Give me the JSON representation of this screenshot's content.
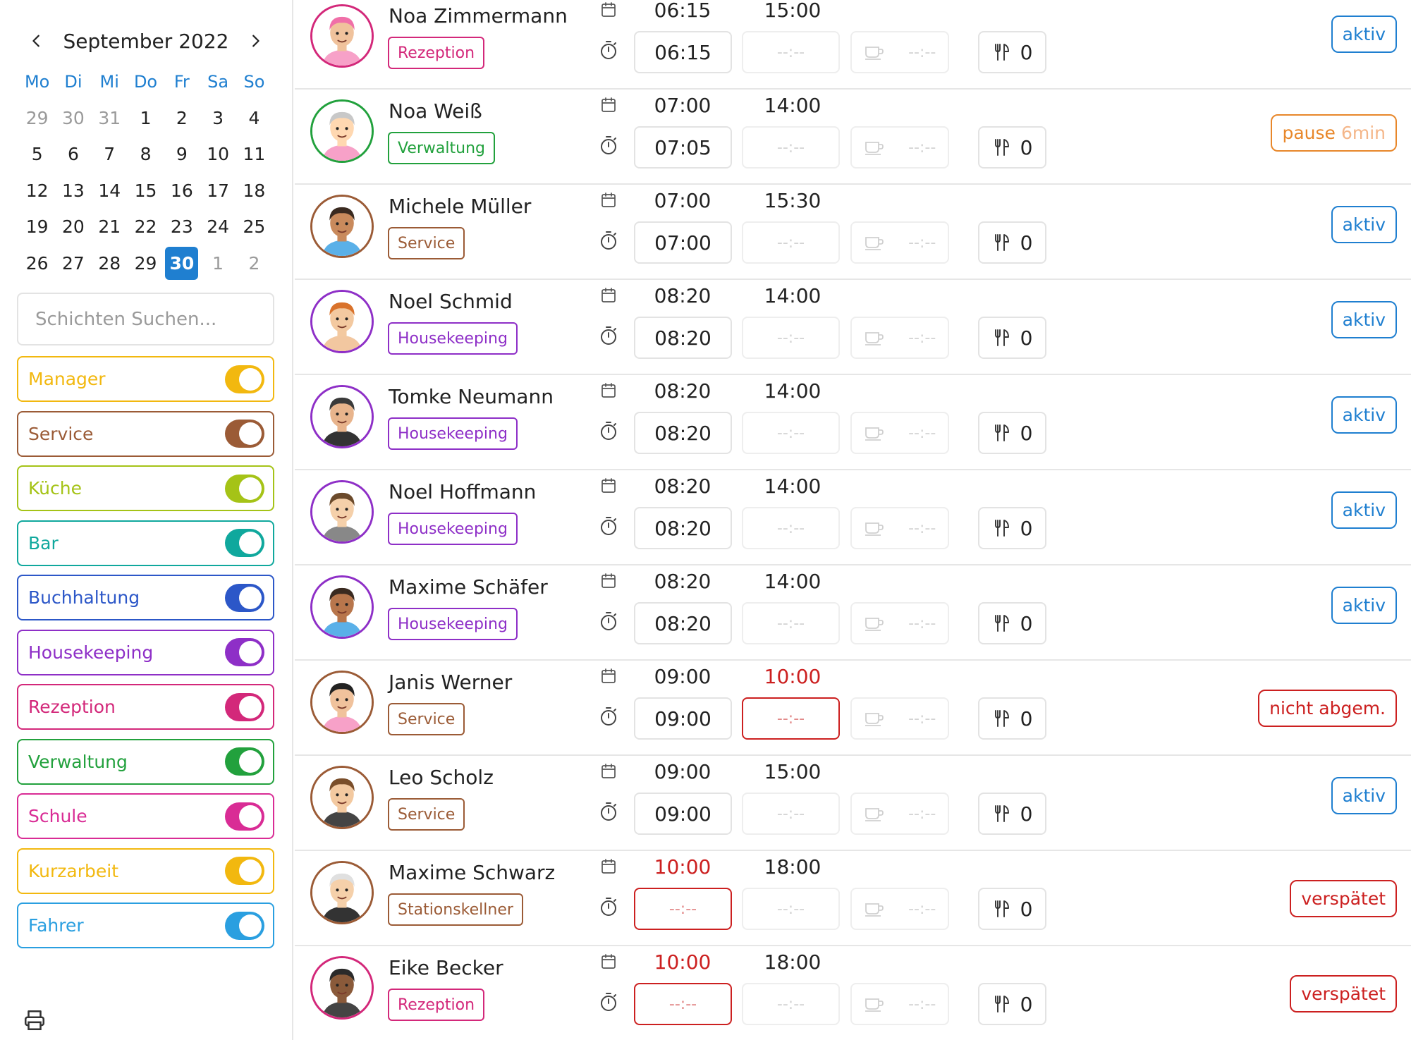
{
  "colors": {
    "accent": "#1f7fd0",
    "alert": "#cc2020",
    "pause": "#e8872a"
  },
  "calendar": {
    "month": "September 2022",
    "weekdays": [
      "Mo",
      "Di",
      "Mi",
      "Do",
      "Fr",
      "Sa",
      "So"
    ],
    "days": [
      {
        "label": "29",
        "muted": true
      },
      {
        "label": "30",
        "muted": true
      },
      {
        "label": "31",
        "muted": true
      },
      {
        "label": "1"
      },
      {
        "label": "2"
      },
      {
        "label": "3"
      },
      {
        "label": "4"
      },
      {
        "label": "5"
      },
      {
        "label": "6"
      },
      {
        "label": "7"
      },
      {
        "label": "8"
      },
      {
        "label": "9"
      },
      {
        "label": "10"
      },
      {
        "label": "11"
      },
      {
        "label": "12"
      },
      {
        "label": "13"
      },
      {
        "label": "14"
      },
      {
        "label": "15"
      },
      {
        "label": "16"
      },
      {
        "label": "17"
      },
      {
        "label": "18"
      },
      {
        "label": "19"
      },
      {
        "label": "20"
      },
      {
        "label": "21"
      },
      {
        "label": "22"
      },
      {
        "label": "23"
      },
      {
        "label": "24"
      },
      {
        "label": "25"
      },
      {
        "label": "26"
      },
      {
        "label": "27"
      },
      {
        "label": "28"
      },
      {
        "label": "29"
      },
      {
        "label": "30",
        "selected": true
      },
      {
        "label": "1",
        "muted": true
      },
      {
        "label": "2",
        "muted": true
      }
    ]
  },
  "search": {
    "placeholder": "Schichten Suchen...",
    "value": ""
  },
  "filters": [
    {
      "label": "Manager",
      "color": "#f2b80f",
      "on": true
    },
    {
      "label": "Service",
      "color": "#9b5b36",
      "on": true
    },
    {
      "label": "Küche",
      "color": "#a5c317",
      "on": true
    },
    {
      "label": "Bar",
      "color": "#10a89d",
      "on": true
    },
    {
      "label": "Buchhaltung",
      "color": "#2c57c8",
      "on": true
    },
    {
      "label": "Housekeeping",
      "color": "#8e2fc7",
      "on": true
    },
    {
      "label": "Rezeption",
      "color": "#d3287a",
      "on": true
    },
    {
      "label": "Verwaltung",
      "color": "#22a13d",
      "on": true
    },
    {
      "label": "Schule",
      "color": "#d92c95",
      "on": true
    },
    {
      "label": "Kurzarbeit",
      "color": "#f2b80f",
      "on": true
    },
    {
      "label": "Fahrer",
      "color": "#2a9fe0",
      "on": true
    }
  ],
  "list_placeholders": {
    "empty_time": "--:--",
    "meal_label": "0"
  },
  "shifts": [
    {
      "name": "Noa Zimmermann",
      "role": "Rezeption",
      "role_color": "#d3287a",
      "avatar": "face-pink-hat-icon",
      "planned_start": "06:15",
      "planned_end": "15:00",
      "actual_start": "06:15",
      "status": "aktiv",
      "status_type": "aktiv"
    },
    {
      "name": "Noa Weiß",
      "role": "Verwaltung",
      "role_color": "#22a13d",
      "avatar": "face-grey-hair-icon",
      "planned_start": "07:00",
      "planned_end": "14:00",
      "actual_start": "07:05",
      "status": "pause",
      "status_extra": "6min",
      "status_type": "pause"
    },
    {
      "name": "Michele Müller",
      "role": "Service",
      "role_color": "#9b5b36",
      "avatar": "face-sunglasses-icon",
      "planned_start": "07:00",
      "planned_end": "15:30",
      "actual_start": "07:00",
      "status": "aktiv",
      "status_type": "aktiv"
    },
    {
      "name": "Noel Schmid",
      "role": "Housekeeping",
      "role_color": "#8e2fc7",
      "avatar": "face-bun-icon",
      "planned_start": "08:20",
      "planned_end": "14:00",
      "actual_start": "08:20",
      "status": "aktiv",
      "status_type": "aktiv"
    },
    {
      "name": "Tomke Neumann",
      "role": "Housekeeping",
      "role_color": "#8e2fc7",
      "avatar": "face-glasses-beard-icon",
      "planned_start": "08:20",
      "planned_end": "14:00",
      "actual_start": "08:20",
      "status": "aktiv",
      "status_type": "aktiv"
    },
    {
      "name": "Noel Hoffmann",
      "role": "Housekeeping",
      "role_color": "#8e2fc7",
      "avatar": "face-flower-crown-icon",
      "planned_start": "08:20",
      "planned_end": "14:00",
      "actual_start": "08:20",
      "status": "aktiv",
      "status_type": "aktiv"
    },
    {
      "name": "Maxime Schäfer",
      "role": "Housekeeping",
      "role_color": "#8e2fc7",
      "avatar": "face-sunglasses-beard-icon",
      "planned_start": "08:20",
      "planned_end": "14:00",
      "actual_start": "08:20",
      "status": "aktiv",
      "status_type": "aktiv"
    },
    {
      "name": "Janis Werner",
      "role": "Service",
      "role_color": "#9b5b36",
      "avatar": "face-long-hair-glasses-icon",
      "planned_start": "09:00",
      "planned_end": "10:00",
      "planned_end_red": true,
      "actual_start": "09:00",
      "end_alert": true,
      "status": "nicht abgem.",
      "status_type": "late"
    },
    {
      "name": "Leo Scholz",
      "role": "Service",
      "role_color": "#9b5b36",
      "avatar": "face-curly-hair-icon",
      "planned_start": "09:00",
      "planned_end": "15:00",
      "actual_start": "09:00",
      "status": "aktiv",
      "status_type": "aktiv"
    },
    {
      "name": "Maxime Schwarz",
      "role": "Stationskellner",
      "role_color": "#9b5b36",
      "avatar": "face-eyepatch-icon",
      "planned_start": "10:00",
      "planned_start_red": true,
      "planned_end": "18:00",
      "actual_start": null,
      "start_alert": true,
      "status": "verspätet",
      "status_type": "late"
    },
    {
      "name": "Eike Becker",
      "role": "Rezeption",
      "role_color": "#d3287a",
      "avatar": "face-sunglasses-bald-icon",
      "planned_start": "10:00",
      "planned_start_red": true,
      "planned_end": "18:00",
      "actual_start": null,
      "start_alert": true,
      "status": "verspätet",
      "status_type": "late"
    }
  ]
}
